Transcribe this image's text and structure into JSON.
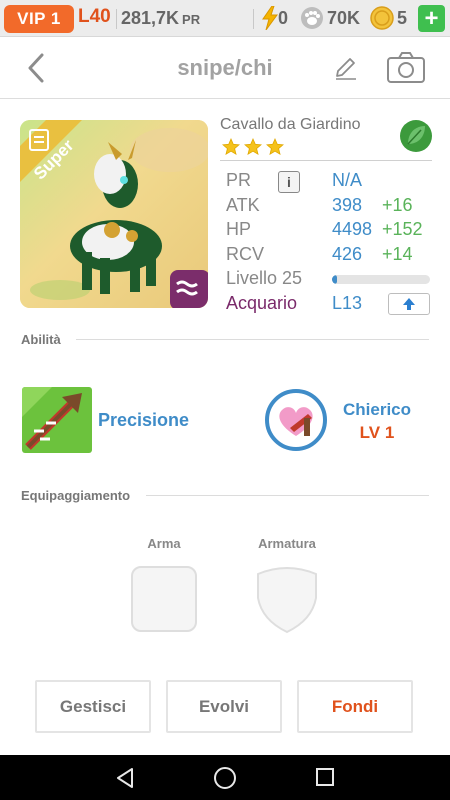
{
  "statusbar": {
    "vip": "VIP 1",
    "level": "L40",
    "pr_value": "281,7K",
    "pr_unit": "PR",
    "energy": "0",
    "food": "70K",
    "coins": "5",
    "plus": "+"
  },
  "header": {
    "title": "snipe/chi"
  },
  "pet": {
    "rarity_ribbon": "Super",
    "name": "Cavallo da Giardino",
    "stars": 3,
    "element_icon": "leaf-icon",
    "stats": [
      {
        "label": "PR",
        "value": "N/A",
        "bonus": "",
        "info": "i"
      },
      {
        "label": "ATK",
        "value": "398",
        "bonus": "+16"
      },
      {
        "label": "HP",
        "value": "4498",
        "bonus": "+152"
      },
      {
        "label": "RCV",
        "value": "426",
        "bonus": "+14"
      }
    ],
    "level_label": "Livello 25",
    "level_progress": 0.05,
    "sign_label": "Acquario",
    "sign_level": "L13"
  },
  "abilities": {
    "section_title": "Abilità",
    "skill_name": "Precisione",
    "class_name": "Chierico",
    "class_level": "LV 1"
  },
  "equipment": {
    "section_title": "Equipaggiamento",
    "weapon_label": "Arma",
    "armor_label": "Armatura"
  },
  "actions": {
    "manage": "Gestisci",
    "evolve": "Evolvi",
    "merge": "Fondi"
  },
  "colors": {
    "accent_orange": "#e0521c",
    "accent_blue": "#3f8cc8",
    "bonus_green": "#5ab35a",
    "plus_green": "#3fbf4f"
  }
}
